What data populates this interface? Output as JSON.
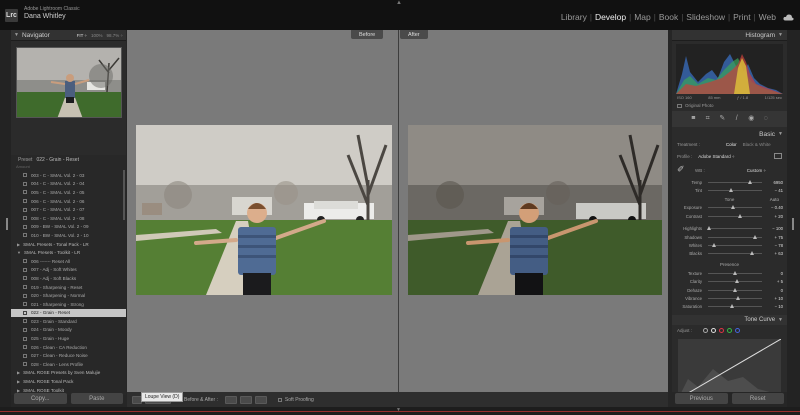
{
  "app": {
    "logo_text": "Lrc",
    "product": "Adobe Lightroom Classic",
    "user": "Dana Whitley"
  },
  "modules": [
    "Library",
    "Develop",
    "Map",
    "Book",
    "Slideshow",
    "Print",
    "Web"
  ],
  "active_module": "Develop",
  "navigator": {
    "title": "Navigator",
    "zoom_options": [
      "FIT ÷",
      "100%",
      "98.7% ÷"
    ]
  },
  "presets": {
    "search_label": "Preset",
    "search_value": "022 - Grain - Reset",
    "amount_label": "Amount",
    "items": [
      {
        "label": "003 - C - SMAL Vol. 2 - 03",
        "type": "item"
      },
      {
        "label": "004 - C - SMAL Vol. 2 - 04",
        "type": "item"
      },
      {
        "label": "005 - C - SMAL Vol. 2 - 05",
        "type": "item"
      },
      {
        "label": "006 - C - SMAL Vol. 2 - 06",
        "type": "item"
      },
      {
        "label": "007 - C - SMAL Vol. 2 - 07",
        "type": "item"
      },
      {
        "label": "008 - C - SMAL Vol. 2 - 08",
        "type": "item"
      },
      {
        "label": "009 - BW - SMAL Vol. 2 - 09",
        "type": "item"
      },
      {
        "label": "010 - BW - SMAL Vol. 2 - 10",
        "type": "item"
      },
      {
        "label": "SMAL Presets - Tonal Pack - LR",
        "type": "group"
      },
      {
        "label": "SMAL Presets - Toolkit - LR",
        "type": "group-open"
      },
      {
        "label": "006 ------- Reset All",
        "type": "item"
      },
      {
        "label": "007 - Adj - Soft Whites",
        "type": "item"
      },
      {
        "label": "008 - Adj - Soft Blacks",
        "type": "item"
      },
      {
        "label": "019 - Sharpening - Reset",
        "type": "item"
      },
      {
        "label": "020 - Sharpening - Normal",
        "type": "item"
      },
      {
        "label": "021 - Sharpening - Strong",
        "type": "item"
      },
      {
        "label": "022 - Grain - Reset",
        "type": "selected"
      },
      {
        "label": "023 - Grain - Standard",
        "type": "item"
      },
      {
        "label": "024 - Grain - Moody",
        "type": "item"
      },
      {
        "label": "025 - Grain - Huge",
        "type": "item"
      },
      {
        "label": "026 - Clean - CA Reduction",
        "type": "item"
      },
      {
        "label": "027 - Clean - Reduce Noise",
        "type": "item"
      },
      {
        "label": "028 - Clean - Lens Profile",
        "type": "item"
      },
      {
        "label": "SMAL ROSE Presets by Sven Malujie",
        "type": "group"
      },
      {
        "label": "SMAL ROSE Tonal Pack",
        "type": "group"
      },
      {
        "label": "SMAL ROSE Toolkit",
        "type": "group"
      }
    ]
  },
  "left_buttons": {
    "copy": "Copy...",
    "paste": "Paste"
  },
  "view": {
    "before_label": "Before",
    "after_label": "After"
  },
  "toolbar": {
    "before_after_label": "Before & After :",
    "soft_proofing_label": "Soft Proofing",
    "tooltip": "Loupe View (D)"
  },
  "histogram": {
    "title": "Histogram",
    "info": [
      "ISO 160",
      "85 mm",
      "ƒ / 1.8",
      "1/125 sec"
    ],
    "original_photo_label": "Original Photo"
  },
  "basic": {
    "title": "Basic",
    "treatment_label": "Treatment :",
    "treatment_options": [
      "Color",
      "Black & White"
    ],
    "selected_treatment": "Color",
    "profile_label": "Profile :",
    "profile_value": "Adobe Standard ÷",
    "wb_label": "WB :",
    "wb_value": "Custom ÷",
    "tone_label": "Tone",
    "auto_label": "Auto",
    "presence_label": "Presence",
    "wb_sliders": [
      {
        "name": "Temp",
        "value": "6950",
        "pos": 0.78
      },
      {
        "name": "Tint",
        "value": "− 41",
        "pos": 0.42
      }
    ],
    "tone_sliders": [
      {
        "name": "Exposure",
        "value": "− 0.40",
        "pos": 0.46
      },
      {
        "name": "Contrast",
        "value": "+ 20",
        "pos": 0.6
      }
    ],
    "tone_sliders_2": [
      {
        "name": "Highlights",
        "value": "− 100",
        "pos": 0.02
      },
      {
        "name": "Shadows",
        "value": "+ 75",
        "pos": 0.87
      },
      {
        "name": "Whites",
        "value": "− 78",
        "pos": 0.12
      },
      {
        "name": "Blacks",
        "value": "+ 63",
        "pos": 0.81
      }
    ],
    "presence_sliders": [
      {
        "name": "Texture",
        "value": "0",
        "pos": 0.5
      },
      {
        "name": "Clarity",
        "value": "+ 5",
        "pos": 0.53
      },
      {
        "name": "Dehaze",
        "value": "0",
        "pos": 0.5
      },
      {
        "name": "Vibrance",
        "value": "+ 10",
        "pos": 0.55
      },
      {
        "name": "Saturation",
        "value": "− 10",
        "pos": 0.45
      }
    ]
  },
  "tone_curve": {
    "title": "Tone Curve",
    "adjust_label": "Adjust :"
  },
  "right_buttons": {
    "previous": "Previous",
    "reset": "Reset"
  }
}
